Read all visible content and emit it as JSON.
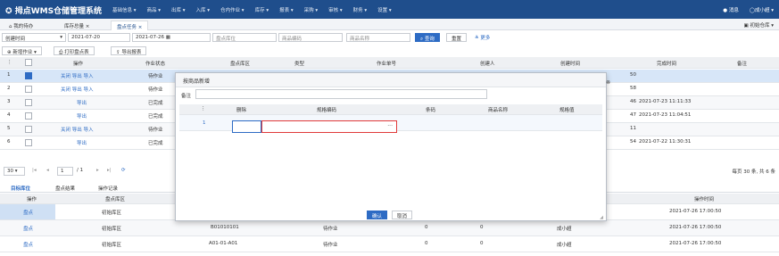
{
  "brand": {
    "title": "拇点WMS仓储管理系统"
  },
  "menu": [
    "基础信息 ▾",
    "商品 ▾",
    "出库 ▾",
    "入库 ▾",
    "仓内作业 ▾",
    "库存 ▾",
    "报表 ▾",
    "采购 ▾",
    "审核 ▾",
    "财务 ▾",
    "设置 ▾"
  ],
  "topright": {
    "messages": "消息",
    "user": "成小超 ▾"
  },
  "tabs": [
    {
      "label": "我的待办"
    },
    {
      "label": "库存总量 ×"
    },
    {
      "label": "盘点任务 ×"
    }
  ],
  "warehouse": "初始仓库 ▾",
  "filters": {
    "time_type": "创建时间",
    "date_from": "2021-07-20",
    "date_to": "2021-07-26",
    "location_placeholder": "盘点库位",
    "product_code_placeholder": "商品编码",
    "product_name_placeholder": "商品名称",
    "search": "查询",
    "reset": "重置",
    "more": "更多"
  },
  "toolbar": {
    "new_task": "新增作业",
    "print": "打印盘点表",
    "export": "导出报表"
  },
  "grid": {
    "headers": [
      "操作",
      "作业状态",
      "盘点库区",
      "类型",
      "作业单号",
      "创建人",
      "创建时间",
      "完成时间",
      "备注"
    ],
    "rows": [
      {
        "no": "1",
        "ops": "关闭 导出 导入",
        "status": "待作业",
        "time": "50",
        "done": ""
      },
      {
        "no": "2",
        "ops": "关闭 导出 导入",
        "status": "待作业",
        "time": "58",
        "done": ""
      },
      {
        "no": "3",
        "ops": "导出",
        "status": "已完成",
        "time": "46",
        "done": "2021-07-23 11:11:33"
      },
      {
        "no": "4",
        "ops": "导出",
        "status": "已完成",
        "time": "47",
        "done": "2021-07-23 11:04:51"
      },
      {
        "no": "5",
        "ops": "关闭 导出 导入",
        "status": "待作业",
        "time": "11",
        "done": ""
      },
      {
        "no": "6",
        "ops": "导出",
        "status": "已完成",
        "time": "54",
        "done": "2021-07-22 11:30:31"
      }
    ]
  },
  "pager": {
    "size": "30",
    "page": "1",
    "total_pages": "/ 1",
    "summary": "每页 30 条, 共 6 条"
  },
  "subtabs": [
    "目标库位",
    "盘点结果",
    "操作记录"
  ],
  "subgrid": {
    "headers": [
      "操作",
      "盘点库区",
      "操作时间"
    ],
    "rows": [
      {
        "op": "盘点",
        "area": "初始库区",
        "loc": "",
        "status": "",
        "a": "",
        "b": "",
        "user": "",
        "time": "2021-07-26 17:00:50"
      },
      {
        "op": "盘点",
        "area": "初始库区",
        "loc": "B01010101",
        "status": "待作业",
        "a": "0",
        "b": "0",
        "user": "成小超",
        "time": "2021-07-26 17:00:50"
      },
      {
        "op": "盘点",
        "area": "初始库区",
        "loc": "A01-01-A01",
        "status": "待作业",
        "a": "0",
        "b": "0",
        "user": "成小超",
        "time": "2021-07-26 17:00:50"
      }
    ]
  },
  "dialog": {
    "title": "按商品新增",
    "remark_label": "备注",
    "headers": [
      "删除",
      "规格编码",
      "条码",
      "商品名称",
      "规格值"
    ],
    "row_no": "1",
    "delete_glyph": "×",
    "ellipsis": "···",
    "ok": "确认",
    "cancel": "取消"
  },
  "colors": {
    "nav": "#1f4e8c",
    "accent": "#2d6bc4",
    "highlight": "#e03a3a"
  }
}
